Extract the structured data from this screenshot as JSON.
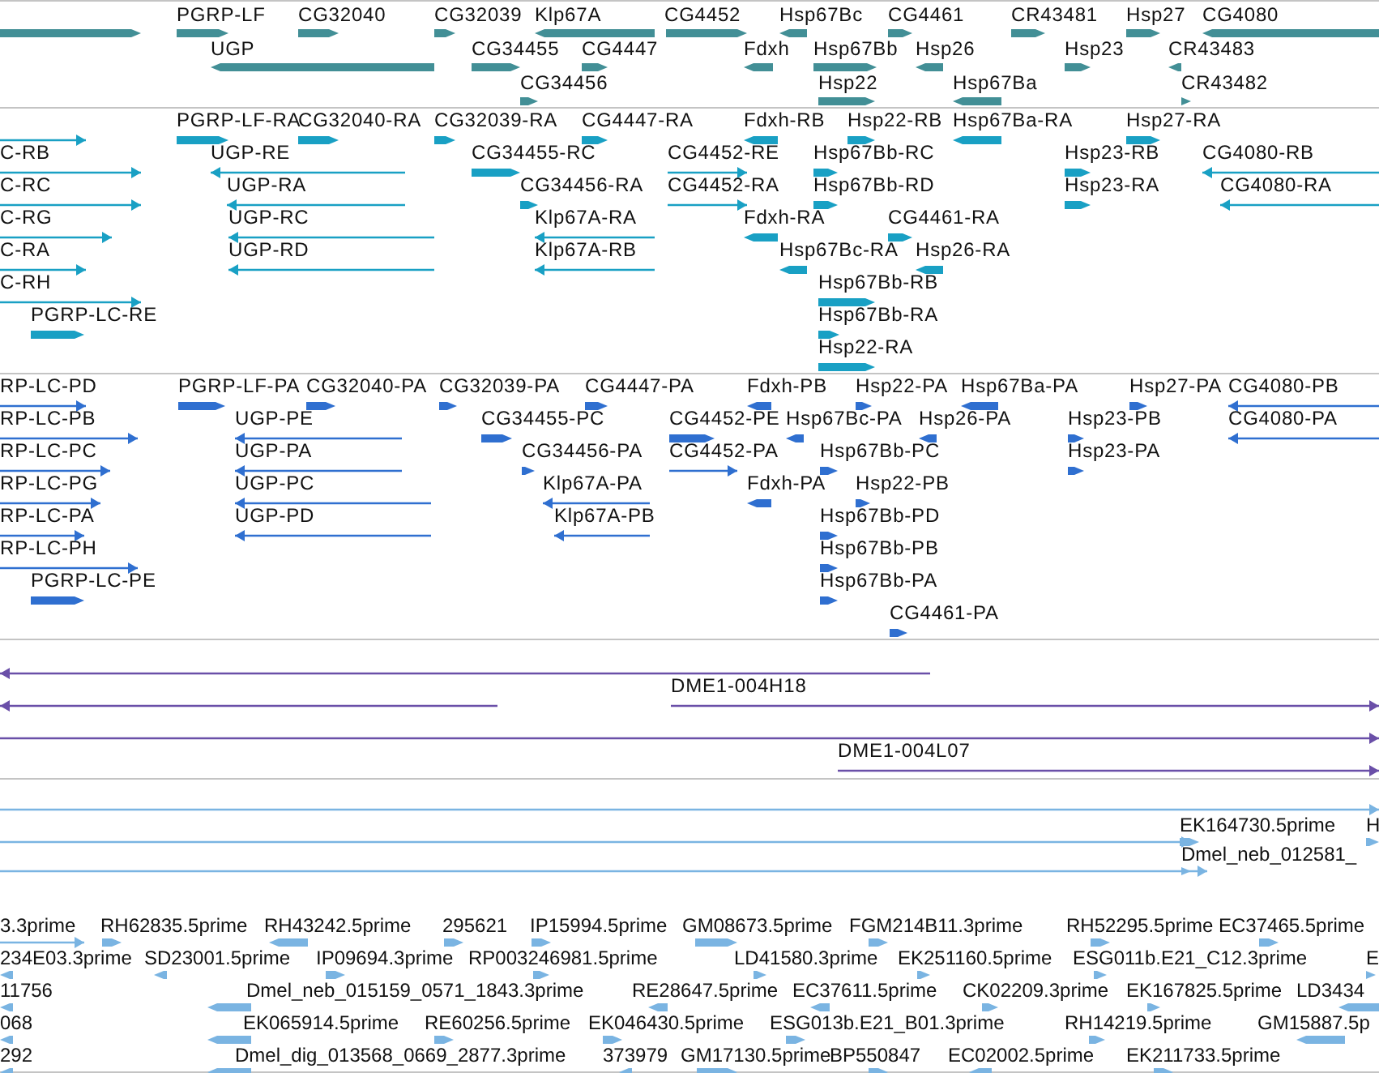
{
  "tracks": [
    {
      "kind": "genes",
      "lanes": [
        {
          "features": [
            {
              "reverse": false
            },
            {
              "label": "PGRP-LF",
              "reverse": false
            },
            {
              "label": "CG32040",
              "reverse": false
            },
            {
              "label": "CG32039",
              "reverse": false
            },
            {
              "label": "Klp67A",
              "reverse": true
            },
            {
              "label": "CG4452",
              "reverse": false
            },
            {
              "label": "Hsp67Bc",
              "reverse": true
            },
            {
              "label": "CG4461",
              "reverse": false
            },
            {
              "label": "CR43481",
              "reverse": false
            },
            {
              "label": "Hsp27",
              "reverse": false
            },
            {
              "label": "CG4080",
              "reverse": true
            }
          ]
        },
        {
          "features": [
            {
              "label": "UGP",
              "reverse": true
            },
            {
              "label": "CG34455",
              "reverse": false
            },
            {
              "label": "CG4447",
              "reverse": false
            },
            {
              "label": "Fdxh",
              "reverse": true
            },
            {
              "label": "Hsp67Bb",
              "reverse": false
            },
            {
              "label": "Hsp26",
              "reverse": true
            },
            {
              "label": "Hsp23",
              "reverse": false
            },
            {
              "label": "CR43483",
              "reverse": true
            }
          ]
        },
        {
          "features": [
            {
              "label": "CG34456",
              "reverse": false
            },
            {
              "label": "Hsp22",
              "reverse": false
            },
            {
              "label": "Hsp67Ba",
              "reverse": true
            },
            {
              "label": "CR43482",
              "reverse": false
            }
          ]
        }
      ]
    },
    {
      "kind": "transcripts",
      "lanes": [
        {
          "features": [
            {
              "reverse": false
            },
            {
              "label": "PGRP-LF-RA",
              "reverse": false
            },
            {
              "label": "CG32040-RA",
              "reverse": false
            },
            {
              "label": "CG32039-RA",
              "reverse": false
            },
            {
              "label": "CG4447-RA",
              "reverse": false
            },
            {
              "label": "Fdxh-RB",
              "reverse": true
            },
            {
              "label": "Hsp22-RB",
              "reverse": false
            },
            {
              "label": "Hsp67Ba-RA",
              "reverse": true
            },
            {
              "label": "Hsp27-RA",
              "reverse": false
            }
          ]
        },
        {
          "features": [
            {
              "label": "C-RB",
              "reverse": false
            },
            {
              "label": "UGP-RE",
              "reverse": true
            },
            {
              "label": "CG34455-RC",
              "reverse": false
            },
            {
              "label": "CG4452-RE",
              "reverse": false
            },
            {
              "label": "Hsp67Bb-RC",
              "reverse": false
            },
            {
              "label": "Hsp23-RB",
              "reverse": false
            },
            {
              "label": "CG4080-RB",
              "reverse": true
            }
          ]
        },
        {
          "features": [
            {
              "label": "C-RC",
              "reverse": false
            },
            {
              "label": "UGP-RA",
              "reverse": true
            },
            {
              "label": "CG34456-RA",
              "reverse": false
            },
            {
              "label": "CG4452-RA",
              "reverse": false
            },
            {
              "label": "Hsp67Bb-RD",
              "reverse": false
            },
            {
              "label": "Hsp23-RA",
              "reverse": false
            },
            {
              "label": "CG4080-RA",
              "reverse": true
            }
          ]
        },
        {
          "features": [
            {
              "label": "C-RG",
              "reverse": false
            },
            {
              "label": "UGP-RC",
              "reverse": true
            },
            {
              "label": "Klp67A-RA",
              "reverse": true
            },
            {
              "label": "Fdxh-RA",
              "reverse": true
            },
            {
              "label": "CG4461-RA",
              "reverse": false
            }
          ]
        },
        {
          "features": [
            {
              "label": "C-RA",
              "reverse": false
            },
            {
              "label": "UGP-RD",
              "reverse": true
            },
            {
              "label": "Klp67A-RB",
              "reverse": true
            },
            {
              "label": "Hsp67Bc-RA",
              "reverse": true
            },
            {
              "label": "Hsp26-RA",
              "reverse": true
            }
          ]
        },
        {
          "features": [
            {
              "label": "C-RH",
              "reverse": false
            },
            {
              "label": "Hsp67Bb-RB",
              "reverse": false
            }
          ]
        },
        {
          "features": [
            {
              "label": "PGRP-LC-RE",
              "reverse": false
            },
            {
              "label": "Hsp67Bb-RA",
              "reverse": false
            }
          ]
        },
        {
          "features": [
            {
              "label": "Hsp22-RA",
              "reverse": false
            }
          ]
        }
      ]
    },
    {
      "kind": "proteins",
      "lanes": [
        {
          "features": [
            {
              "label": "RP-LC-PD",
              "reverse": false
            },
            {
              "label": "PGRP-LF-PA",
              "reverse": false
            },
            {
              "label": "CG32040-PA",
              "reverse": false
            },
            {
              "label": "CG32039-PA",
              "reverse": false
            },
            {
              "label": "CG4447-PA",
              "reverse": false
            },
            {
              "label": "Fdxh-PB",
              "reverse": true
            },
            {
              "label": "Hsp22-PA",
              "reverse": false
            },
            {
              "label": "Hsp67Ba-PA",
              "reverse": true
            },
            {
              "label": "Hsp27-PA",
              "reverse": false
            },
            {
              "label": "CG4080-PB",
              "reverse": true
            }
          ]
        },
        {
          "features": [
            {
              "label": "RP-LC-PB",
              "reverse": false
            },
            {
              "label": "UGP-PE",
              "reverse": true
            },
            {
              "label": "CG34455-PC",
              "reverse": false
            },
            {
              "label": "CG4452-PE",
              "reverse": false
            },
            {
              "label": "Hsp67Bc-PA",
              "reverse": true
            },
            {
              "label": "Hsp26-PA",
              "reverse": true
            },
            {
              "label": "Hsp23-PB",
              "reverse": false
            },
            {
              "label": "CG4080-PA",
              "reverse": true
            }
          ]
        },
        {
          "features": [
            {
              "label": "RP-LC-PC",
              "reverse": false
            },
            {
              "label": "UGP-PA",
              "reverse": true
            },
            {
              "label": "CG34456-PA",
              "reverse": false
            },
            {
              "label": "CG4452-PA",
              "reverse": false
            },
            {
              "label": "Hsp67Bb-PC",
              "reverse": false
            },
            {
              "label": "Hsp23-PA",
              "reverse": false
            }
          ]
        },
        {
          "features": [
            {
              "label": "RP-LC-PG",
              "reverse": false
            },
            {
              "label": "UGP-PC",
              "reverse": true
            },
            {
              "label": "Klp67A-PA",
              "reverse": true
            },
            {
              "label": "Fdxh-PA",
              "reverse": true
            },
            {
              "label": "Hsp22-PB",
              "reverse": false
            }
          ]
        },
        {
          "features": [
            {
              "label": "RP-LC-PA",
              "reverse": false
            },
            {
              "label": "UGP-PD",
              "reverse": true
            },
            {
              "label": "Klp67A-PB",
              "reverse": true
            },
            {
              "label": "Hsp67Bb-PD",
              "reverse": false
            }
          ]
        },
        {
          "features": [
            {
              "label": "RP-LC-PH",
              "reverse": false
            },
            {
              "label": "Hsp67Bb-PB",
              "reverse": false
            }
          ]
        },
        {
          "features": [
            {
              "label": "PGRP-LC-PE",
              "reverse": false
            },
            {
              "label": "Hsp67Bb-PA",
              "reverse": false
            }
          ]
        },
        {
          "features": [
            {
              "label": "CG4461-PA",
              "reverse": false
            }
          ]
        }
      ]
    },
    {
      "kind": "clones",
      "lanes": [
        {
          "features": [
            {
              "reverse": true
            }
          ]
        },
        {
          "features": [
            {
              "reverse": true
            },
            {
              "label": "DME1-004H18",
              "reverse": false
            }
          ]
        },
        {
          "features": [
            {
              "reverse": false
            }
          ]
        },
        {
          "features": [
            {
              "label": "DME1-004L07",
              "reverse": false
            }
          ]
        }
      ]
    },
    {
      "kind": "ests",
      "lanes": [
        {
          "features": [
            {
              "reverse": false
            }
          ]
        },
        {
          "features": [
            {
              "reverse": false
            },
            {
              "label": "EK164730.5prime",
              "reverse": false
            },
            {
              "label": "H",
              "reverse": false
            }
          ]
        },
        {
          "features": [
            {
              "reverse": false
            },
            {
              "label": "Dmel_neb_012581_",
              "reverse": false
            }
          ]
        },
        {
          "features": [
            {
              "label": "3.3prime",
              "reverse": false
            },
            {
              "label": "RH62835.5prime",
              "reverse": false
            },
            {
              "label": "RH43242.5prime",
              "reverse": true
            },
            {
              "label": "295621",
              "reverse": false
            },
            {
              "label": "IP15994.5prime",
              "reverse": false
            },
            {
              "label": "GM08673.5prime",
              "reverse": false
            },
            {
              "label": "FGM214B11.3prime",
              "reverse": false
            },
            {
              "label": "RH52295.5prime",
              "reverse": false
            },
            {
              "label": "EC37465.5prime",
              "reverse": false
            }
          ]
        },
        {
          "features": [
            {
              "label": "234E03.3prime",
              "reverse": true
            },
            {
              "label": "SD23001.5prime",
              "reverse": true
            },
            {
              "label": "IP09694.3prime",
              "reverse": false
            },
            {
              "label": "RP003246981.5prime",
              "reverse": false
            },
            {
              "label": "LD41580.3prime",
              "reverse": false
            },
            {
              "label": "EK251160.5prime",
              "reverse": false
            },
            {
              "label": "ESG011b.E21_C12.3prime",
              "reverse": false
            },
            {
              "label": "E",
              "reverse": false
            }
          ]
        },
        {
          "features": [
            {
              "label": "11756",
              "reverse": true
            },
            {
              "label": "Dmel_neb_015159_0571_1843.3prime",
              "reverse": true
            },
            {
              "label": "RE28647.5prime",
              "reverse": true
            },
            {
              "label": "EC37611.5prime",
              "reverse": true
            },
            {
              "label": "CK02209.3prime",
              "reverse": false
            },
            {
              "label": "EK167825.5prime",
              "reverse": false
            },
            {
              "label": "LD3434",
              "reverse": true
            }
          ]
        },
        {
          "features": [
            {
              "label": "068",
              "reverse": true
            },
            {
              "label": "EK065914.5prime",
              "reverse": true
            },
            {
              "label": "RE60256.5prime",
              "reverse": false
            },
            {
              "label": "EK046430.5prime",
              "reverse": false
            },
            {
              "label": "ESG013b.E21_B01.3prime",
              "reverse": false
            },
            {
              "label": "RH14219.5prime",
              "reverse": false
            },
            {
              "label": "GM15887.5p",
              "reverse": true
            }
          ]
        },
        {
          "features": [
            {
              "label": "292",
              "reverse": true
            },
            {
              "label": "Dmel_dig_013568_0669_2877.3prime",
              "reverse": true
            },
            {
              "label": "373979",
              "reverse": true
            },
            {
              "label": "GM17130.5prime",
              "reverse": false
            },
            {
              "label": "BP550847",
              "reverse": false
            },
            {
              "label": "EC02002.5prime",
              "reverse": true
            },
            {
              "label": "EK211733.5prime",
              "reverse": false
            }
          ]
        }
      ]
    }
  ]
}
